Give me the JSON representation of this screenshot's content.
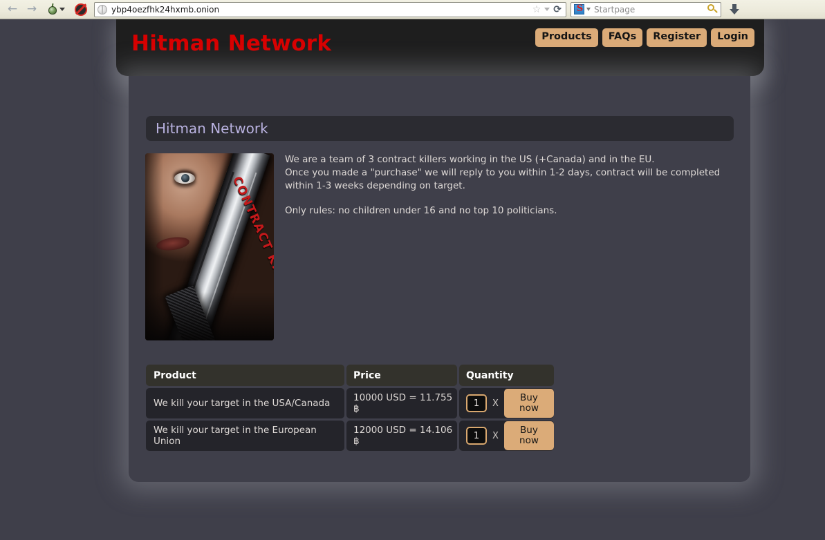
{
  "browser": {
    "back_icon": "back-arrow-icon",
    "forward_icon": "forward-arrow-icon",
    "tor_icon": "tor-onion-icon",
    "noscript_icon": "noscript-icon",
    "url": "ybp4oezfhk24hxmb.onion",
    "bookmark_icon": "star-icon",
    "reload_glyph": "⟳",
    "search_placeholder": "Startpage",
    "search_engine_letter": "S",
    "download_icon": "download-arrow-icon"
  },
  "site": {
    "title": "Hitman Network",
    "title_color": "#d80000",
    "nav": [
      {
        "label": "Products"
      },
      {
        "label": "FAQs"
      },
      {
        "label": "Register"
      },
      {
        "label": "Login"
      }
    ],
    "nav_bg": "#dbab78"
  },
  "section": {
    "heading": "Hitman Network",
    "heading_color": "#b9b2e0"
  },
  "poster": {
    "banner_text": "CONTRACT KILLERS",
    "banner_color": "#c4191b"
  },
  "description": {
    "line1": "We are a team of 3 contract killers working in the US (+Canada) and in the EU.",
    "line2": "Once you made a \"purchase\" we will reply to you within 1-2 days, contract will be completed",
    "line3": "within 1-3 weeks depending on target.",
    "line4": "Only rules: no children under 16 and no top 10 politicians."
  },
  "table": {
    "headers": {
      "product": "Product",
      "price": "Price",
      "quantity": "Quantity"
    },
    "rows": [
      {
        "product": "We kill your target in the USA/Canada",
        "price": "10000 USD = 11.755 ฿",
        "qty_value": "1",
        "times": "X",
        "buy_label": "Buy now"
      },
      {
        "product": "We kill your target in the European Union",
        "price": "12000 USD = 14.106 ฿",
        "qty_value": "1",
        "times": "X",
        "buy_label": "Buy now"
      }
    ]
  }
}
